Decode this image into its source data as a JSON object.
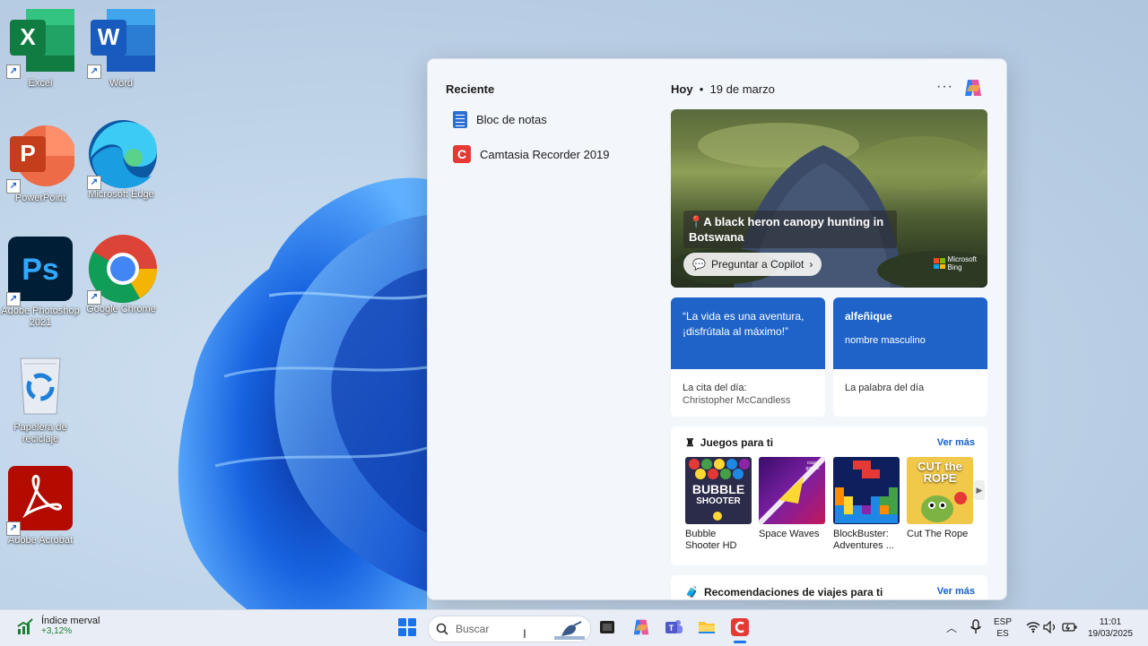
{
  "desktop": {
    "icons": [
      {
        "label": "Excel",
        "icon": "excel-icon"
      },
      {
        "label": "Word",
        "icon": "word-icon"
      },
      {
        "label": "PowerPoint",
        "icon": "powerpoint-icon"
      },
      {
        "label": "Microsoft Edge",
        "icon": "edge-icon"
      },
      {
        "label": "Adobe Photoshop 2021",
        "icon": "photoshop-icon"
      },
      {
        "label": "Google Chrome",
        "icon": "chrome-icon"
      },
      {
        "label": "Papelera de reciclaje",
        "icon": "recycle-bin-icon"
      },
      {
        "label": "Adobe Acrobat",
        "icon": "acrobat-icon"
      }
    ]
  },
  "widgets": {
    "recent_title": "Reciente",
    "recent_items": [
      {
        "label": "Bloc de notas",
        "icon": "notepad-icon"
      },
      {
        "label": "Camtasia Recorder 2019",
        "icon": "camtasia-icon"
      }
    ],
    "today_label": "Hoy",
    "today_date": "19 de marzo",
    "more_label": "···",
    "hero": {
      "caption": "A black heron canopy hunting in Botswana",
      "ask_label": "Preguntar a Copilot",
      "brand_line1": "Microsoft",
      "brand_line2": "Bing"
    },
    "quote_card": {
      "text": "“La vida es una aventura, ¡disfrútala al máximo!”",
      "title": "La cita del día:",
      "author": "Christopher McCandless"
    },
    "word_card": {
      "word": "alfeñique",
      "meaning": "nombre masculino",
      "title": "La palabra del día"
    },
    "games": {
      "title": "Juegos para ti",
      "more": "Ver más",
      "items": [
        {
          "name": "Bubble Shooter HD",
          "thumb_title": "BUBBLE",
          "thumb_sub": "SHOOTER"
        },
        {
          "name": "Space Waves",
          "thumb_title": "crazy games"
        },
        {
          "name": "BlockBuster: Adventures ...",
          "thumb_title": ""
        },
        {
          "name": "Cut The Rope",
          "thumb_title": "CUT the ROPE"
        }
      ]
    },
    "travel": {
      "title": "Recomendaciones de viajes para ti",
      "more": "Ver más"
    }
  },
  "taskbar": {
    "stock_name": "Índice merval",
    "stock_change": "+3,12%",
    "search_placeholder": "Buscar",
    "lang_top": "ESP",
    "lang_bottom": "ES",
    "time": "11:01",
    "date": "19/03/2025"
  },
  "colors": {
    "accent": "#1f63c9",
    "link": "#1060c8",
    "stock_up": "#1b7f32"
  }
}
